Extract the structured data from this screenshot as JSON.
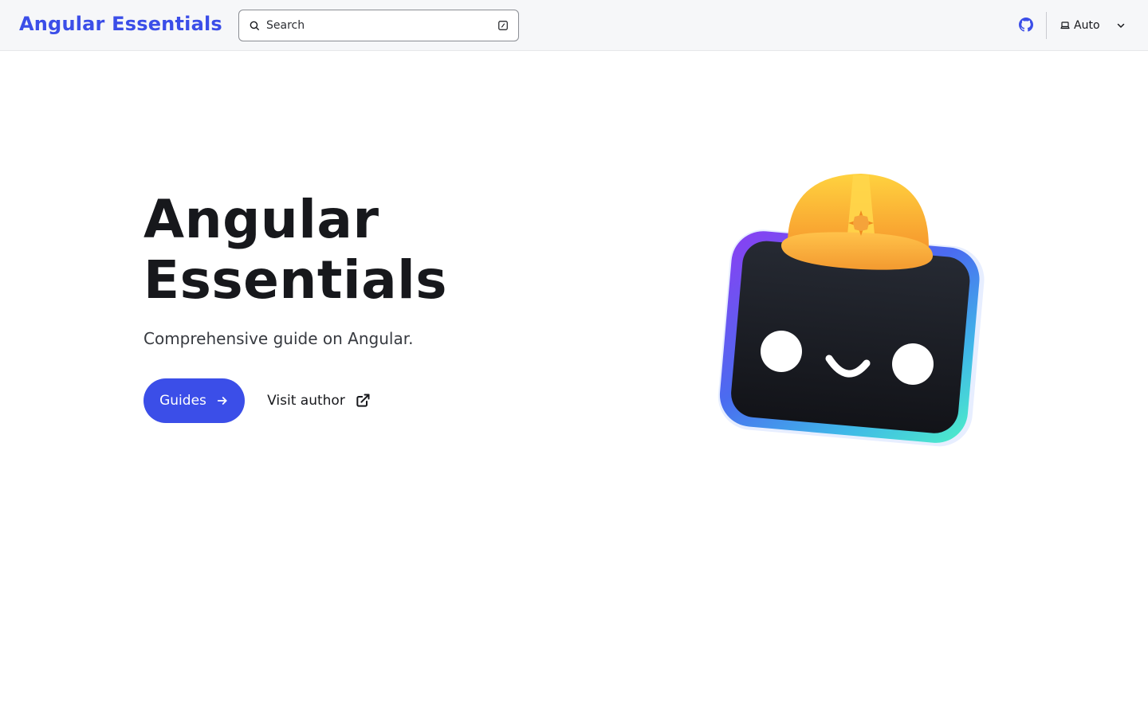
{
  "header": {
    "site_title": "Angular Essentials",
    "search": {
      "placeholder": "Search"
    },
    "github_icon": "github-icon",
    "theme": {
      "selected": "Auto",
      "icon": "laptop-icon"
    }
  },
  "hero": {
    "title_line1": "Angular",
    "title_line2": "Essentials",
    "tagline": "Comprehensive guide on Angular.",
    "actions": {
      "primary_label": "Guides",
      "secondary_label": "Visit author"
    },
    "image": "mascot-with-hard-hat"
  },
  "colors": {
    "accent": "#3b4ee8",
    "header_bg": "#f6f7f9",
    "text": "#17181c",
    "mascot_body": "#17181c",
    "helmet": "#f9a83a"
  }
}
